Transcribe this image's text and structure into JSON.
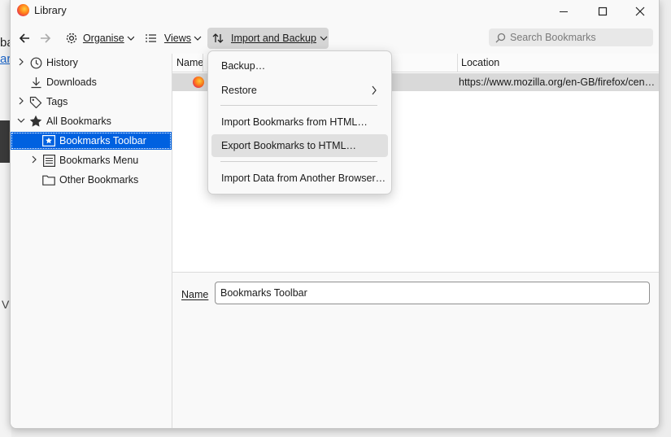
{
  "background": {
    "text_top": "ba",
    "text_link": "ar",
    "text_bottom": "V"
  },
  "window": {
    "title": "Library",
    "app_icon": "firefox-icon"
  },
  "toolbar": {
    "organise": "Organise",
    "views": "Views",
    "import_backup": "Import and Backup",
    "search_placeholder": "Search Bookmarks"
  },
  "sidebar": {
    "items": [
      {
        "label": "History",
        "icon": "clock-icon"
      },
      {
        "label": "Downloads",
        "icon": "download-icon"
      },
      {
        "label": "Tags",
        "icon": "tag-icon"
      },
      {
        "label": "All Bookmarks",
        "icon": "star-icon"
      },
      {
        "label": "Bookmarks Toolbar",
        "icon": "bookmarks-toolbar-icon"
      },
      {
        "label": "Bookmarks Menu",
        "icon": "bookmarks-menu-icon"
      },
      {
        "label": "Other Bookmarks",
        "icon": "folder-icon"
      }
    ],
    "selected": "Bookmarks Toolbar"
  },
  "table": {
    "columns": [
      "Name",
      "Location"
    ],
    "rows": [
      {
        "name": "",
        "location": "https://www.mozilla.org/en-GB/firefox/central/"
      }
    ]
  },
  "menu": {
    "items": [
      "Backup…",
      "Restore",
      "Import Bookmarks from HTML…",
      "Export Bookmarks to HTML…",
      "Import Data from Another Browser…"
    ],
    "hovered": "Export Bookmarks to HTML…"
  },
  "details": {
    "name_label": "Name",
    "name_value": "Bookmarks Toolbar"
  },
  "colors": {
    "selection": "#0061e0",
    "menu_hover": "#e0e0e0",
    "row_selected": "#d9d9d9"
  }
}
